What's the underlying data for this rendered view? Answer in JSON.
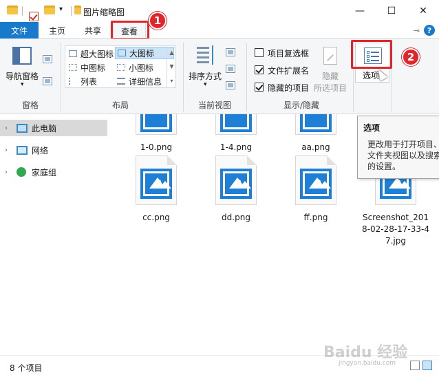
{
  "window": {
    "title": "图片缩略图",
    "controls": {
      "minimize": "—",
      "maximize": "☐",
      "close": "✕"
    }
  },
  "tabs": {
    "file": "文件",
    "home": "主页",
    "share": "共享",
    "view": "查看"
  },
  "annotations": {
    "badge_1": "1",
    "badge_2": "2",
    "highlight_color": "#e0262a"
  },
  "ribbon": {
    "panes": {
      "nav_pane_label": "导航窗格",
      "group_label": "窗格"
    },
    "layout": {
      "group_label": "布局",
      "items": [
        {
          "label": "超大图标",
          "selected": false
        },
        {
          "label": "大图标",
          "selected": true
        },
        {
          "label": "中图标",
          "selected": false
        },
        {
          "label": "小图标",
          "selected": false
        },
        {
          "label": "列表",
          "selected": false
        },
        {
          "label": "详细信息",
          "selected": false
        }
      ]
    },
    "current_view": {
      "sort_label": "排序方式",
      "group_label": "当前视图"
    },
    "show_hide": {
      "group_label": "显示/隐藏",
      "item_checkboxes": {
        "label": "项目复选框",
        "checked": false
      },
      "file_extensions": {
        "label": "文件扩展名",
        "checked": true
      },
      "hidden_items": {
        "label": "隐藏的项目",
        "checked": true
      },
      "hide_selected_line1": "隐藏",
      "hide_selected_line2": "所选项目"
    },
    "options": {
      "label": "选项"
    }
  },
  "tooltip": {
    "title": "选项",
    "lines": [
      "更改用于打开项目、",
      "文件夹视图以及搜索",
      "的设置。"
    ]
  },
  "nav": {
    "items": [
      {
        "label": "此电脑",
        "selected": true
      },
      {
        "label": "网络",
        "selected": false
      },
      {
        "label": "家庭组",
        "selected": false
      }
    ]
  },
  "files": [
    {
      "name": "1-0.png"
    },
    {
      "name": "1-4.png"
    },
    {
      "name": "aa.png"
    },
    {
      "name": "cc.png"
    },
    {
      "name": "dd.png"
    },
    {
      "name": "ff.png"
    },
    {
      "name": "Screenshot_2018-02-28-17-33-47.jpg"
    }
  ],
  "status": {
    "item_count": "8 个项目"
  },
  "watermark": {
    "text": "Baidu 经验",
    "sub": "jingyan.baidu.com"
  }
}
